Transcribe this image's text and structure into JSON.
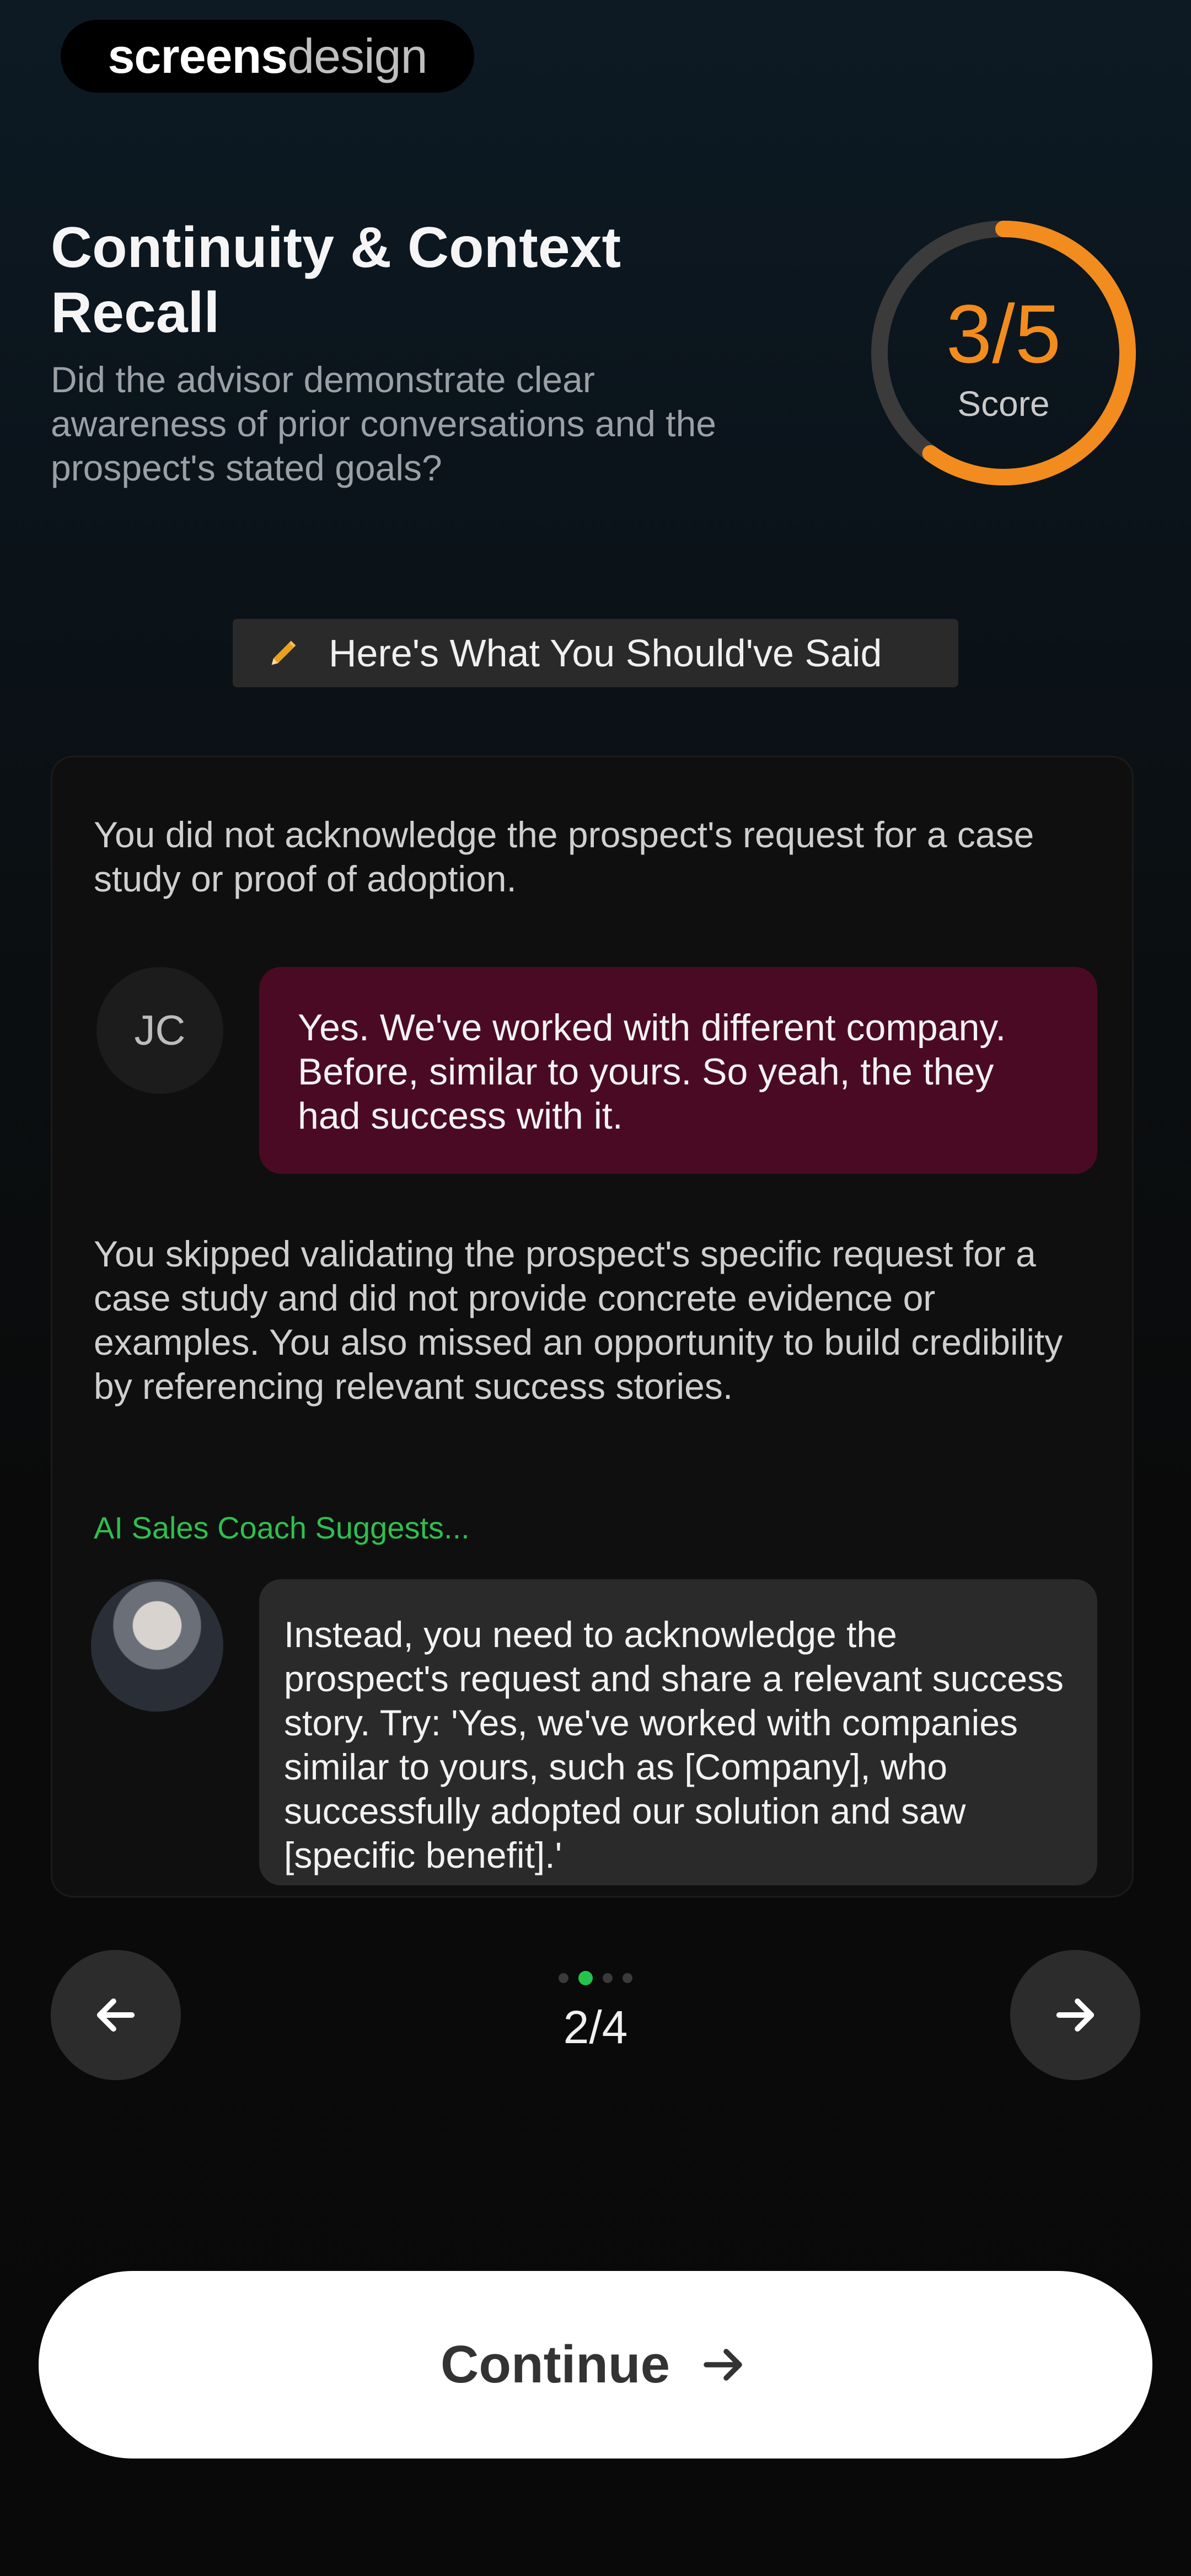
{
  "watermark": {
    "strong": "screens",
    "light": "design"
  },
  "header": {
    "title": "Continuity & Context Recall",
    "subtitle": "Did the advisor demonstrate clear awareness of prior conversations and the prospect's stated goals?"
  },
  "score": {
    "value": "3/5",
    "label": "Score",
    "fraction": 0.6,
    "accent": "#f28c1e"
  },
  "section_chip": {
    "label": "Here's What You Should've Said",
    "icon": "pencil-icon"
  },
  "card": {
    "feedback_1": "You did not acknowledge the prospect's request for a case study or proof of adoption.",
    "user_avatar_initials": "JC",
    "user_message": "Yes. We've worked with different company. Before, similar to yours. So yeah, the they had success with it.",
    "feedback_2": "You skipped validating the prospect's specific request for a case study and did not provide concrete evidence or examples. You also missed an opportunity to build credibility by referencing relevant success stories.",
    "coach_label": "AI Sales Coach Suggests...",
    "coach_message": "Instead, you need to acknowledge the prospect's request and share a relevant success story. Try: 'Yes, we've worked with companies similar to yours, such as [Company], who successfully adopted our solution and saw [specific benefit].'"
  },
  "pagination": {
    "current": 2,
    "total": 4,
    "label": "2/4"
  },
  "footer": {
    "continue_label": "Continue"
  },
  "colors": {
    "user_bubble": "#4b0a23",
    "coach_bubble": "#2a2a2a",
    "coach_label": "#2fbf4f",
    "active_dot": "#27c24c"
  }
}
